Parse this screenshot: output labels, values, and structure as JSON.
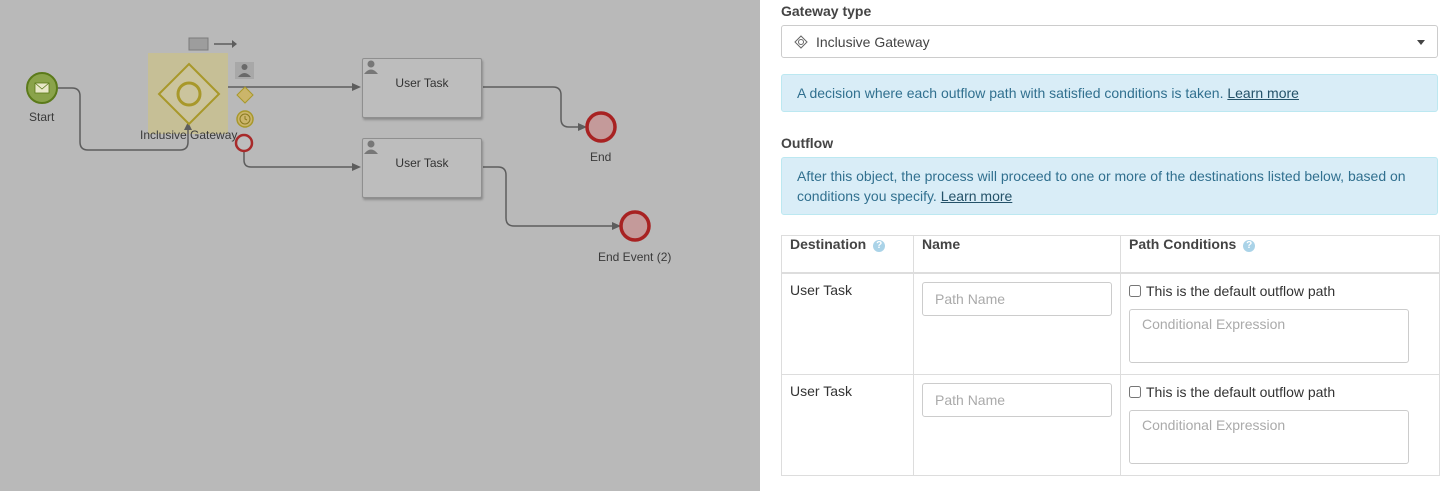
{
  "canvas": {
    "labels": {
      "start": "Start",
      "gateway": "Inclusive Gateway",
      "end": "End",
      "end2": "End Event (2)"
    },
    "tasks": [
      "User Task",
      "User Task"
    ]
  },
  "panel": {
    "gateway_type_label": "Gateway type",
    "gateway_type_value": "Inclusive Gateway",
    "gateway_info": "A decision where each outflow path with satisfied conditions is taken.",
    "gateway_info_link": "Learn more",
    "outflow_label": "Outflow",
    "outflow_info": "After this object, the process will proceed to one or more of the destinations listed below, based on conditions you specify.",
    "outflow_info_link": "Learn more",
    "table": {
      "headers": {
        "destination": "Destination",
        "name": "Name",
        "conditions": "Path Conditions"
      },
      "rows": [
        {
          "destination": "User Task",
          "name_placeholder": "Path Name",
          "default_label": "This is the default outflow path",
          "cond_placeholder": "Conditional Expression"
        },
        {
          "destination": "User Task",
          "name_placeholder": "Path Name",
          "default_label": "This is the default outflow path",
          "cond_placeholder": "Conditional Expression"
        }
      ]
    }
  },
  "colors": {
    "info_bg": "#d9edf7",
    "info_text": "#31708f",
    "canvas_overlay": "#b9b9b9",
    "start_event": "#7a9a2a",
    "end_event": "#b22a2a",
    "gateway_highlight": "#cfc79c"
  }
}
